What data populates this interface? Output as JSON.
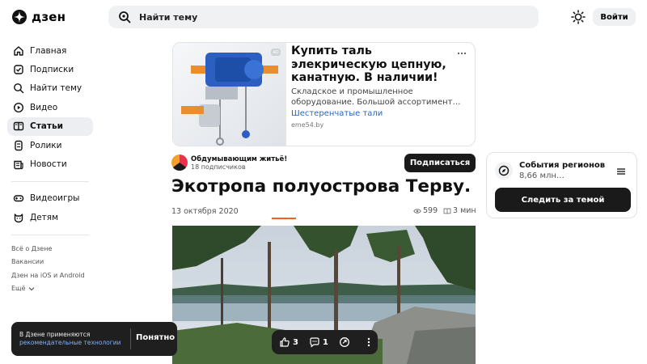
{
  "header": {
    "logo_text": "дзен",
    "search_placeholder": "Найти тему",
    "login_label": "Войти"
  },
  "sidebar": {
    "items": [
      {
        "label": "Главная",
        "icon": "home-icon"
      },
      {
        "label": "Подписки",
        "icon": "subscriptions-icon"
      },
      {
        "label": "Найти тему",
        "icon": "search-icon"
      },
      {
        "label": "Видео",
        "icon": "video-icon"
      },
      {
        "label": "Статьи",
        "icon": "articles-icon",
        "active": true
      },
      {
        "label": "Ролики",
        "icon": "clips-icon"
      },
      {
        "label": "Новости",
        "icon": "news-icon"
      }
    ],
    "items2": [
      {
        "label": "Видеоигры",
        "icon": "gamepad-icon"
      },
      {
        "label": "Детям",
        "icon": "kids-icon"
      }
    ],
    "footer": [
      "Всё о Дзене",
      "Вакансии",
      "Дзен на iOS и Android",
      "Ещё"
    ]
  },
  "ad": {
    "badge": "AD",
    "title": "Купить таль элекрическую цепную, канатную. В наличии!",
    "description": "Складское и промышленное оборудование. Большой ассортимент…",
    "link": "Шестеренчатые тали",
    "domain": "eme54.by"
  },
  "channel": {
    "name": "Обдумывающим житьё!",
    "subscribers": "18 подписчиков",
    "subscribe_label": "Подписаться"
  },
  "article": {
    "title": "Экотропа полуострова Терву.",
    "date": "13 октября 2020",
    "views": "599",
    "read_time": "3 мин",
    "read_progress": 0.08
  },
  "widget": {
    "title": "События регионов",
    "subtitle": "8,66 млн…",
    "button": "Следить за темой"
  },
  "cookie": {
    "text": "В Дзене применяются",
    "link": "рекомендательные технологии",
    "button": "Понятно"
  },
  "actions": {
    "likes": "3",
    "comments": "1"
  },
  "colors": {
    "accent": "#ff5a1f",
    "link": "#2367c7",
    "dark": "#1a1a1a"
  }
}
